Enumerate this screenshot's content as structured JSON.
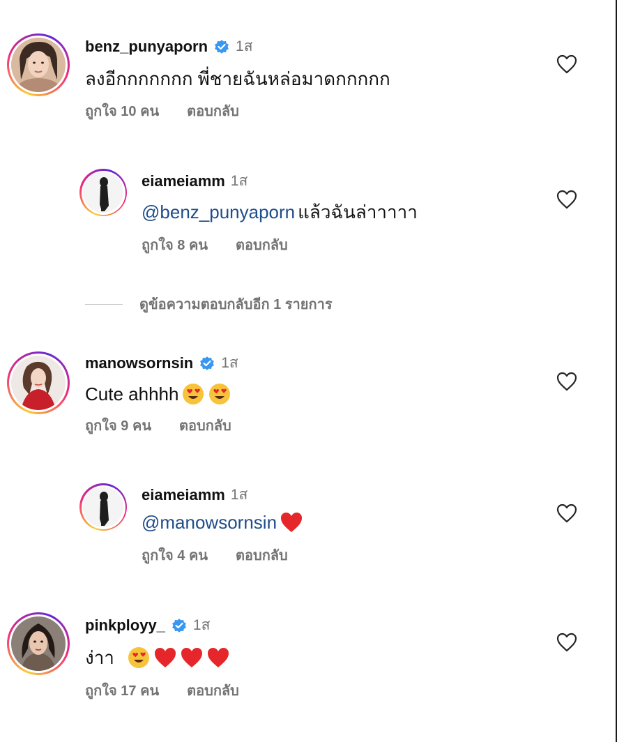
{
  "comments": [
    {
      "username": "benz_punyaporn",
      "verified": true,
      "time": "1ส",
      "text": "ลงอีกกกกกกก พี่ชายฉันหล่อมาดกกกกก",
      "likes": "ถูกใจ 10 คน",
      "reply": "ตอบกลับ",
      "replies": [
        {
          "username": "eiameiamm",
          "time": "1ส",
          "mention": "@benz_punyaporn",
          "text": " แล้วฉันล่าาาาา",
          "likes": "ถูกใจ 8 คน",
          "reply": "ตอบกลับ"
        }
      ],
      "view_more": "ดูข้อความตอบกลับอีก 1 รายการ"
    },
    {
      "username": "manowsornsin",
      "verified": true,
      "time": "1ส",
      "text": "Cute ahhhh",
      "likes": "ถูกใจ 9 คน",
      "reply": "ตอบกลับ",
      "replies": [
        {
          "username": "eiameiamm",
          "time": "1ส",
          "mention": "@manowsornsin",
          "text": "",
          "likes": "ถูกใจ 4 คน",
          "reply": "ตอบกลับ"
        }
      ]
    },
    {
      "username": "pinkployy_",
      "verified": true,
      "time": "1ส",
      "text": "ง่าา",
      "likes": "ถูกใจ 17 คน",
      "reply": "ตอบกลับ"
    }
  ],
  "icons": {
    "verified": "verified-badge-icon",
    "like": "heart-outline-icon"
  },
  "colors": {
    "verified": "#3897f0",
    "mention": "#1f4d8a",
    "muted": "#737373"
  }
}
